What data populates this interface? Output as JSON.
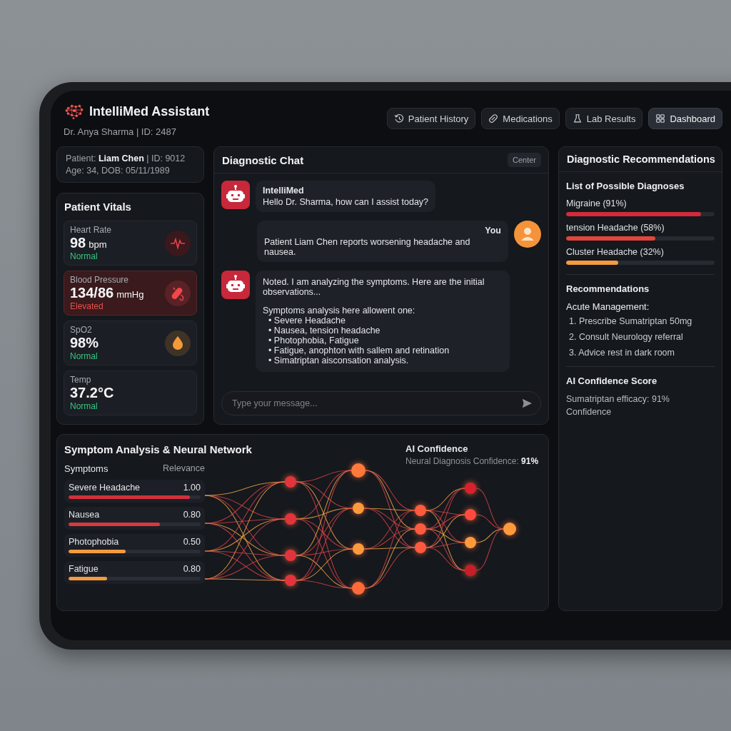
{
  "app": {
    "title": "IntelliMed Assistant",
    "doctor": "Dr. Anya Sharma | ID: 2487"
  },
  "nav": [
    {
      "label": "Patient History",
      "kind": "history",
      "selected": false
    },
    {
      "label": "Medications",
      "kind": "medication",
      "selected": false
    },
    {
      "label": "Lab Results",
      "kind": "lab",
      "selected": false
    },
    {
      "label": "Dashboard",
      "kind": "dashboard",
      "selected": true
    }
  ],
  "patient": {
    "line_1": "Patient: **Liam Chen** | ID: 9012",
    "line_2": "Age: 34,  DOB: 05/11/1989"
  },
  "vitals": {
    "title": "Patient Vitals",
    "items": [
      {
        "label": "Heart Rate",
        "value": "98",
        "unit": "bpm",
        "status": "Normal",
        "alert": false,
        "kind": "heart"
      },
      {
        "label": "Blood Pressure",
        "value": "134/86",
        "unit": "mmHg",
        "status": "Elevated",
        "alert": true,
        "kind": "pressure"
      },
      {
        "label": "SpO2",
        "value": "98%",
        "status": "Normal",
        "alert": false,
        "kind": "oxygen"
      },
      {
        "label": "Temp",
        "value": "37.2°C",
        "status": "Normal",
        "alert": false
      }
    ]
  },
  "chat": {
    "title": "Diagnostic Chat",
    "action": "Center",
    "messages": [
      {
        "kind": "bot",
        "sender": "IntelliMed",
        "text": "Hello Dr. Sharma, how can I assist today?"
      },
      {
        "kind": "user",
        "sender": "You",
        "text": "Patient Liam Chen reports worsening headache and nausea."
      },
      {
        "kind": "bot",
        "text": "Noted. I am analyzing the symptoms. Here are the initial observations...",
        "intro": "Symptoms analysis here allowent one:",
        "bullets": [
          "• Severe Headache",
          "• Nausea, tension headache",
          "• Photophobia, Fatigue",
          "• Fatigue, anophton with sallem and retination",
          "• Simatriptan aisconsation analysis."
        ]
      }
    ],
    "placeholder": "Type your message..."
  },
  "recommendations": {
    "title": "Diagnostic Recommendations",
    "diagnoses_title": "List of Possible Diagnoses",
    "diagnoses": [
      {
        "label": "Migraine (91%)",
        "level": 0.91,
        "color": "#d42a3c"
      },
      {
        "label": "tension Headache (58%)",
        "level": 0.6,
        "color": "#e0463c"
      },
      {
        "label": "Cluster Headache (32%)",
        "level": 0.35,
        "color": "#f59a40"
      }
    ],
    "section_title": "Recommendations",
    "subtitle": "Acute Management:",
    "steps": [
      "1. Prescribe Sumatriptan 50mg",
      "2. Consult Neurology referral",
      "3. Advice rest in dark room"
    ],
    "confidence_title": "AI Confidence Score",
    "confidence_text": "Sumatriptan efficacy: 91% Confidence"
  },
  "symptom_analysis": {
    "title": "Symptom Analysis & Neural Network",
    "columns": [
      "Symptoms",
      "Relevance"
    ],
    "symptoms": [
      {
        "name": "Severe Headache",
        "score": "1.00",
        "level": 0.92,
        "color": "#d2303c"
      },
      {
        "name": "Nausea",
        "score": "0.80",
        "level": 0.69,
        "color": "#d63a3c"
      },
      {
        "name": "Photophobia",
        "score": "0.50",
        "level": 0.43,
        "color": "#f59a40"
      },
      {
        "name": "Fatigue",
        "score": "0.80",
        "level": 0.29,
        "color": "#f59a40"
      }
    ],
    "confidence": {
      "title": "AI Confidence",
      "text": "Neural Diagnosis Confidence: **91%**"
    }
  }
}
